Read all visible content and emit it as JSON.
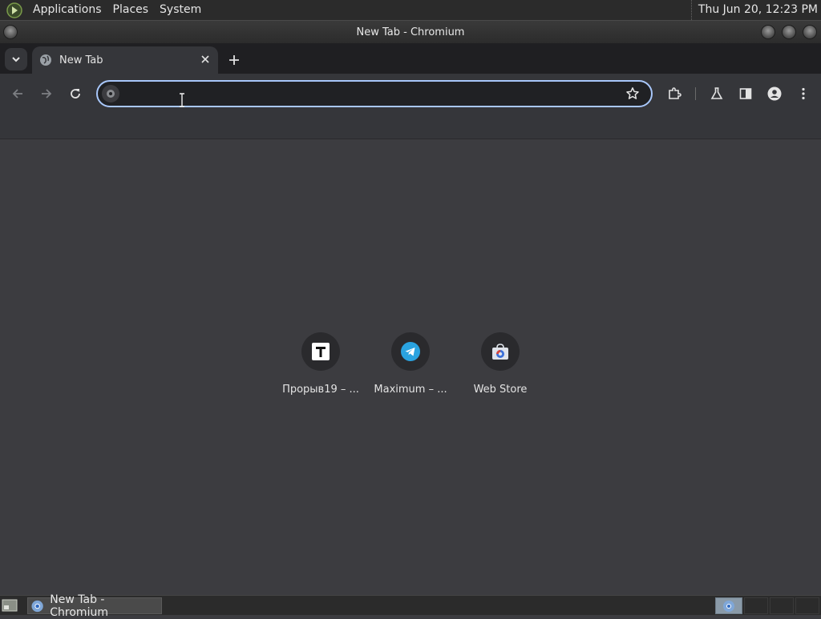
{
  "top_panel": {
    "menus": [
      "Applications",
      "Places",
      "System"
    ],
    "clock": "Thu Jun 20, 12:23 PM"
  },
  "window": {
    "title": "New Tab - Chromium"
  },
  "tabs": [
    {
      "title": "New Tab",
      "favicon": "globe-icon",
      "active": true
    }
  ],
  "toolbar": {
    "address_value": "",
    "address_placeholder": "",
    "buttons": [
      "back-icon",
      "forward-icon",
      "reload-icon",
      "bookmark-star-icon",
      "extensions-icon",
      "labs-flask-icon",
      "side-panel-icon",
      "profile-icon",
      "menu-icon"
    ]
  },
  "new_tab_page": {
    "shortcuts": [
      {
        "label": "Прорыв19 – ...",
        "icon": "t-letter-icon"
      },
      {
        "label": "Maximum – ...",
        "icon": "telegram-icon"
      },
      {
        "label": "Web Store",
        "icon": "web-store-icon"
      }
    ]
  },
  "taskbar": {
    "tasks": [
      {
        "label": "New Tab - Chromium",
        "icon": "chromium-icon"
      }
    ],
    "workspace_count": 4,
    "active_workspace": 1
  },
  "colors": {
    "panel_bg": "#2b2b2b",
    "toolbar_bg": "#35363a",
    "content_bg": "#3c3c40",
    "omnibox_focus": "#a8c7fa",
    "telegram_blue": "#2aa3e0"
  }
}
